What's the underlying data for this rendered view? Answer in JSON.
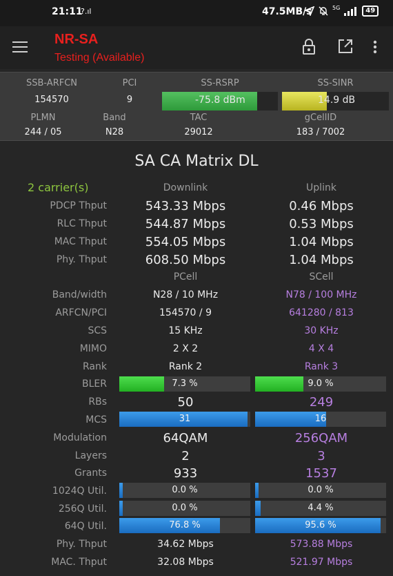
{
  "status": {
    "time": "21:11",
    "small_signal": "?.ıl",
    "speed": "47.5MB/s",
    "signal_5g": "5G",
    "battery": "49"
  },
  "appbar": {
    "title": "NR-SA",
    "subtitle": "Testing (Available)",
    "icons": [
      "menu-icon",
      "lock-icon",
      "open-external-icon",
      "more-vert-icon"
    ]
  },
  "info": {
    "ssb_arfcn_label": "SSB-ARFCN",
    "ssb_arfcn": "154570",
    "pci_label": "PCI",
    "pci": "9",
    "rsrp_label": "SS-RSRP",
    "rsrp": "-75.8 dBm",
    "rsrp_level": 0.82,
    "sinr_label": "SS-SINR",
    "sinr": "14.9 dB",
    "sinr_level": 0.42,
    "plmn_label": "PLMN",
    "plmn": "244 / 05",
    "band_label": "Band",
    "band": "N28",
    "tac_label": "TAC",
    "tac": "29012",
    "gcellid_label": "gCellID",
    "gcellid": "183 / 7002",
    "colors": {
      "rsrp": "#3aaa46",
      "sinr": "#d4d040"
    }
  },
  "matrix": {
    "title": "SA CA Matrix DL",
    "carriers": "2 carrier(s)",
    "downlink_label": "Downlink",
    "uplink_label": "Uplink",
    "throughput": [
      {
        "label": "PDCP Thput",
        "dl": "543.33 Mbps",
        "ul": "0.46 Mbps"
      },
      {
        "label": "RLC Thput",
        "dl": "544.87 Mbps",
        "ul": "0.53 Mbps"
      },
      {
        "label": "MAC Thput",
        "dl": "554.05 Mbps",
        "ul": "1.04 Mbps"
      },
      {
        "label": "Phy. Thput",
        "dl": "608.50 Mbps",
        "ul": "1.04 Mbps"
      }
    ],
    "pcell_label": "PCell",
    "scell_label": "SCell",
    "cells": [
      {
        "label": "Band/width",
        "p": "N28 / 10 MHz",
        "s": "N78 / 100 MHz"
      },
      {
        "label": "ARFCN/PCI",
        "p": "154570 / 9",
        "s": "641280 / 813"
      },
      {
        "label": "SCS",
        "p": "15 KHz",
        "s": "30 KHz"
      },
      {
        "label": "MIMO",
        "p": "2 X 2",
        "s": "4 X 4"
      },
      {
        "label": "Rank",
        "p": "Rank 2",
        "s": "Rank 3"
      }
    ],
    "bler": {
      "label": "BLER",
      "p": "7.3 %",
      "p_level": 0.34,
      "s": "9.0 %",
      "s_level": 0.37
    },
    "rbs": {
      "label": "RBs",
      "p": "50",
      "s": "249"
    },
    "mcs": {
      "label": "MCS",
      "p": "31",
      "p_level": 0.98,
      "s": "16",
      "s_level": 0.54
    },
    "modulation": {
      "label": "Modulation",
      "p": "64QAM",
      "s": "256QAM"
    },
    "layers": {
      "label": "Layers",
      "p": "2",
      "s": "3"
    },
    "grants": {
      "label": "Grants",
      "p": "933",
      "s": "1537"
    },
    "util": [
      {
        "label": "1024Q Util.",
        "p": "0.0 %",
        "p_level": 0.0,
        "s": "0.0 %",
        "s_level": 0.0
      },
      {
        "label": "256Q Util.",
        "p": "0.0 %",
        "p_level": 0.0,
        "s": "4.4 %",
        "s_level": 0.044
      },
      {
        "label": "64Q Util.",
        "p": "76.8 %",
        "p_level": 0.768,
        "s": "95.6 %",
        "s_level": 0.956
      }
    ],
    "phy_thput": {
      "label": "Phy. Thput",
      "p": "34.62 Mbps",
      "s": "573.88 Mbps"
    },
    "mac_thput": {
      "label": "MAC. Thput",
      "p": "32.08 Mbps",
      "s": "521.97 Mbps"
    },
    "colors": {
      "scell_text": "#b77fe0",
      "carriers": "#8ec63f",
      "bler_bar": "#2fc42f",
      "mcs_bar": "#2a84d8"
    }
  }
}
